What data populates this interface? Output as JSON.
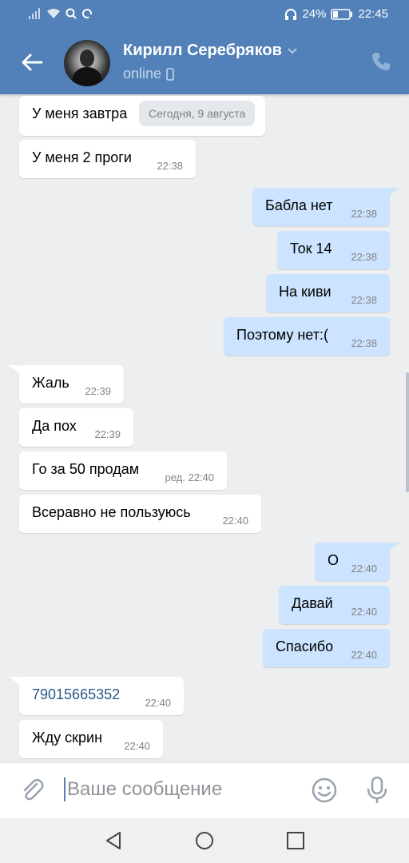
{
  "status_bar": {
    "battery": "24%",
    "time": "22:45"
  },
  "header": {
    "contact_name": "Кирилл Серебряков",
    "status": "online"
  },
  "date_separator": "Сегодня, 9 августа",
  "messages": [
    {
      "dir": "in",
      "text": "У меня завтра",
      "time": ""
    },
    {
      "dir": "in",
      "text": "У меня 2 проги",
      "time": "22:38"
    },
    {
      "dir": "out",
      "text": "Бабла нет",
      "time": "22:38"
    },
    {
      "dir": "out",
      "text": "Ток 14",
      "time": "22:38"
    },
    {
      "dir": "out",
      "text": "На киви",
      "time": "22:38"
    },
    {
      "dir": "out",
      "text": "Поэтому нет:(",
      "time": "22:38"
    },
    {
      "dir": "in",
      "text": "Жаль",
      "time": "22:39"
    },
    {
      "dir": "in",
      "text": "Да пох",
      "time": "22:39"
    },
    {
      "dir": "in",
      "text": "Го за 50 продам",
      "time": "ред. 22:40"
    },
    {
      "dir": "in",
      "text": "Всеравно не пользуюсь",
      "time": "22:40"
    },
    {
      "dir": "out",
      "text": "О",
      "time": "22:40"
    },
    {
      "dir": "out",
      "text": "Давай",
      "time": "22:40"
    },
    {
      "dir": "out",
      "text": "Спасибо",
      "time": "22:40"
    },
    {
      "dir": "in",
      "text": "79015665352",
      "time": "22:40"
    },
    {
      "dir": "in",
      "text": "Жду скрин",
      "time": "22:40"
    }
  ],
  "composer": {
    "placeholder": "Ваше сообщение"
  },
  "icons": [
    "signal-icon",
    "wifi-icon",
    "search-icon",
    "sync-icon",
    "headphones-icon",
    "battery-icon",
    "back-arrow-icon",
    "chevron-down-icon",
    "phone-device-icon",
    "call-icon",
    "paperclip-icon",
    "emoji-icon",
    "microphone-icon",
    "nav-back-icon",
    "nav-home-icon",
    "nav-recent-icon"
  ],
  "colors": {
    "brand": "#5181b8",
    "outgoing_bubble": "#cce4ff",
    "incoming_bubble": "#ffffff",
    "background": "#edeef0",
    "link": "#2a5885"
  }
}
